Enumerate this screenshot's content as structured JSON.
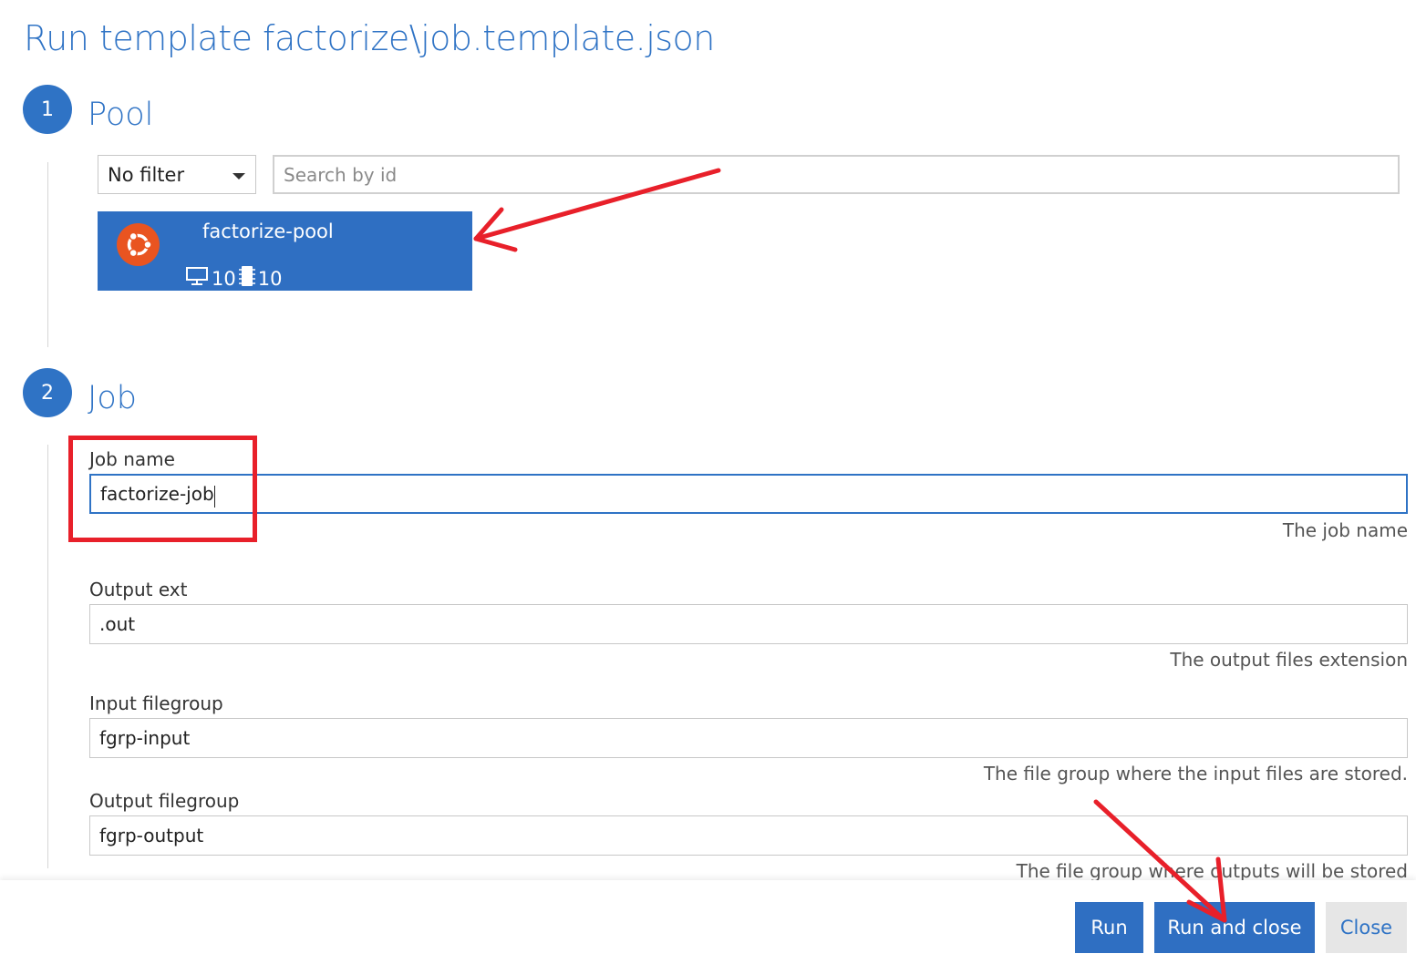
{
  "dialog": {
    "title": "Run template factorize\\job.template.json"
  },
  "steps": [
    {
      "number": "1",
      "title": "Pool"
    },
    {
      "number": "2",
      "title": "Job"
    }
  ],
  "pool_section": {
    "filter": {
      "selected": "No filter"
    },
    "search": {
      "placeholder": "Search by id",
      "value": ""
    },
    "pools": [
      {
        "name": "factorize-pool",
        "os_icon": "ubuntu-icon",
        "dedicated_nodes": "10",
        "low_priority_nodes": "10",
        "selected": true
      }
    ]
  },
  "job_section": {
    "fields": [
      {
        "label": "Job name",
        "value": "factorize-job",
        "help": "The job name"
      },
      {
        "label": "Output ext",
        "value": ".out",
        "help": "The output files extension"
      },
      {
        "label": "Input filegroup",
        "value": "fgrp-input",
        "help": "The file group where the input files are stored."
      },
      {
        "label": "Output filegroup",
        "value": "fgrp-output",
        "help": "The file group where outputs will be stored"
      }
    ]
  },
  "footer": {
    "run_label": "Run",
    "run_and_close_label": "Run and close",
    "close_label": "Close"
  },
  "colors": {
    "accent": "#2f73c5",
    "pool_selected": "#2f6fc2",
    "ubuntu": "#e95420",
    "annotation": "#e8202a"
  }
}
